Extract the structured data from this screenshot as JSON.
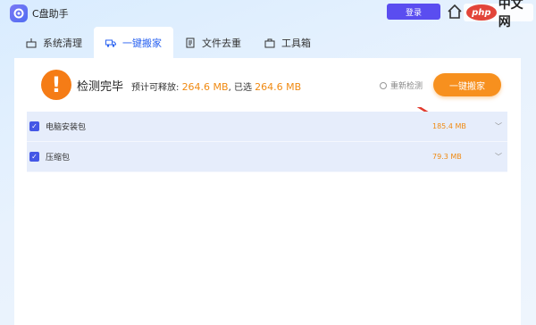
{
  "app": {
    "title": "C盘助手",
    "login_label": "登录",
    "watermark_logo": "php",
    "watermark_text": "中文网"
  },
  "tabs": [
    {
      "label": "系统清理",
      "icon": "broom-icon",
      "active": false
    },
    {
      "label": "一键搬家",
      "icon": "truck-icon",
      "active": true
    },
    {
      "label": "文件去重",
      "icon": "file-icon",
      "active": false
    },
    {
      "label": "工具箱",
      "icon": "toolbox-icon",
      "active": false
    }
  ],
  "status": {
    "icon": "!",
    "title": "检测完毕",
    "releasable_label": "预计可释放:",
    "releasable_value": "264.6 MB",
    "selected_label": ", 已选",
    "selected_value": "264.6 MB",
    "rescan_label": "重新检测",
    "move_button_label": "一键搬家"
  },
  "items": [
    {
      "name": "电脑安装包",
      "size": "185.4 MB",
      "checked": true
    },
    {
      "name": "压缩包",
      "size": "79.3 MB",
      "checked": true
    }
  ],
  "colors": {
    "accent": "#f7901e",
    "brand": "#5a4df0",
    "tab_active": "#2a62f0",
    "row_bg": "#e6edfb"
  }
}
